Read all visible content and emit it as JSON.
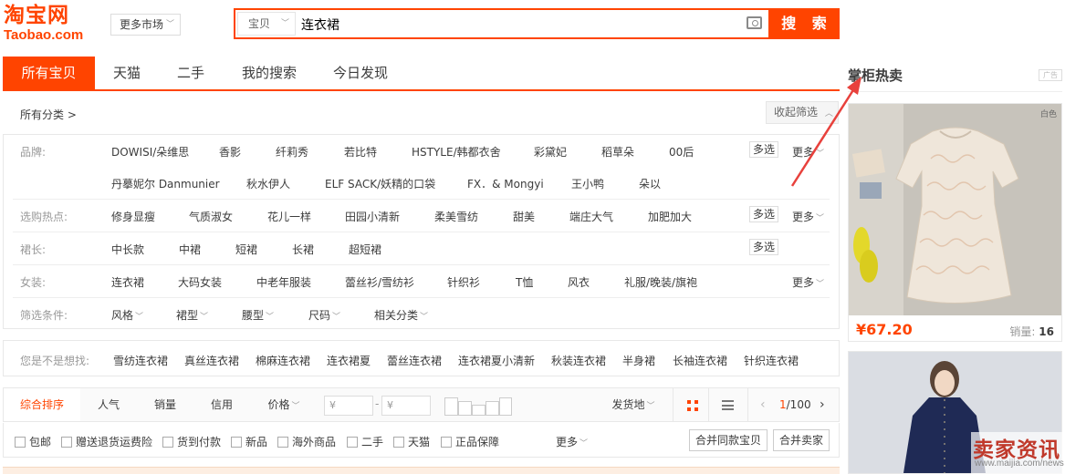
{
  "header": {
    "logo_cn": "淘宝网",
    "logo_en": "Taobao.com",
    "market_label": "更多市场",
    "search_type": "宝贝",
    "search_query": "连衣裙",
    "search_button": "搜 索"
  },
  "tabs": [
    "所有宝贝",
    "天猫",
    "二手",
    "我的搜索",
    "今日发现"
  ],
  "sidebar": {
    "title": "掌柜热卖",
    "ad_badge": "广告",
    "products": [
      {
        "price": "¥67.20",
        "sales_label": "销量:",
        "sales_count": "16",
        "corner_tag": "白色"
      },
      {
        "price": "",
        "sales_label": "",
        "sales_count": ""
      }
    ]
  },
  "filter": {
    "breadcrumb": "所有分类 >",
    "collapse_label": "收起筛选",
    "multi_label": "多选",
    "more_label": "更多",
    "rows": {
      "brand": {
        "label": "品牌:",
        "values": [
          "DOWISI/朵维思",
          "香影",
          "纤莉秀",
          "若比特",
          "HSTYLE/韩都衣舍",
          "彩黛妃",
          "稻草朵",
          "00后",
          "丹摹妮尔 Danmunier",
          "秋水伊人",
          "ELF SACK/妖精的口袋",
          "FX．& Mongyi",
          "王小鸭",
          "朵以"
        ]
      },
      "hot": {
        "label": "选购热点:",
        "values": [
          "修身显瘦",
          "气质淑女",
          "花儿一样",
          "田园小清新",
          "柔美雪纺",
          "甜美",
          "端庄大气",
          "加肥加大"
        ]
      },
      "length": {
        "label": "裙长:",
        "values": [
          "中长款",
          "中裙",
          "短裙",
          "长裙",
          "超短裙"
        ]
      },
      "womens": {
        "label": "女装:",
        "values": [
          "连衣裙",
          "大码女装",
          "中老年服装",
          "蕾丝衫/雪纺衫",
          "针织衫",
          "T恤",
          "风衣",
          "礼服/晚装/旗袍"
        ]
      },
      "conditions": {
        "label": "筛选条件:",
        "values": [
          "风格",
          "裙型",
          "腰型",
          "尺码",
          "相关分类"
        ]
      }
    }
  },
  "suggestions": {
    "label": "您是不是想找:",
    "items": [
      "雪纺连衣裙",
      "真丝连衣裙",
      "棉麻连衣裙",
      "连衣裙夏",
      "蕾丝连衣裙",
      "连衣裙夏小清新",
      "秋装连衣裙",
      "半身裙",
      "长袖连衣裙",
      "针织连衣裙"
    ]
  },
  "sortbar": {
    "sorts": [
      "综合排序",
      "人气",
      "销量",
      "信用",
      "价格"
    ],
    "price_from": "¥",
    "price_to": "¥",
    "price_dash": "-",
    "ship_from": "发货地",
    "page_current": "1",
    "page_total": "/100"
  },
  "checks": {
    "items": [
      "包邮",
      "赠送退货运费险",
      "货到付款",
      "新品",
      "海外商品",
      "二手",
      "天猫",
      "正品保障"
    ],
    "more": "更多",
    "merge_same": "合并同款宝贝",
    "merge_seller": "合并卖家"
  },
  "watermark": {
    "cn": "卖家资讯",
    "url": "www.maijia.com/news"
  },
  "colors": {
    "accent": "#ff4400",
    "annotation_arrow": "#e8413c"
  }
}
